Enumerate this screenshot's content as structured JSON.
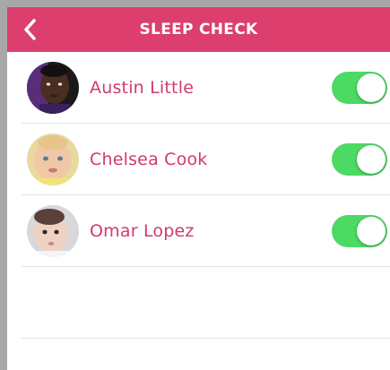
{
  "header": {
    "title": "SLEEP CHECK",
    "back_icon": "chevron-left-icon"
  },
  "colors": {
    "header_bg": "#dc3f6e",
    "name_text": "#d23a6a",
    "toggle_on": "#4cd964"
  },
  "children": [
    {
      "name": "Austin Little",
      "checked": true
    },
    {
      "name": "Chelsea Cook",
      "checked": true
    },
    {
      "name": "Omar Lopez",
      "checked": true
    }
  ]
}
